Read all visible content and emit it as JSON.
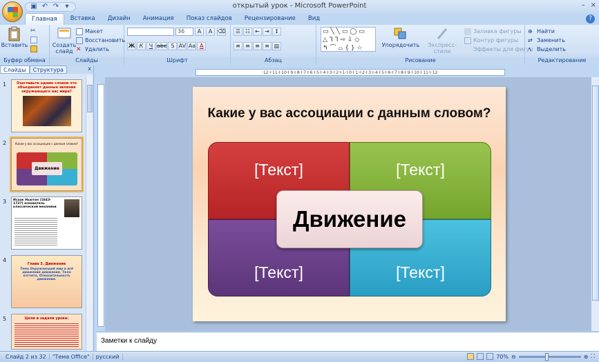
{
  "window": {
    "title": "открытый урок - Microsoft PowerPoint",
    "minimize": "–",
    "close": "×"
  },
  "tabs": [
    "Главная",
    "Вставка",
    "Дизайн",
    "Анимация",
    "Показ слайдов",
    "Рецензирование",
    "Вид"
  ],
  "ribbon": {
    "clipboard": {
      "paste": "Вставить",
      "label": "Буфер обмена"
    },
    "slides": {
      "create": "Создать слайд",
      "layout": "Макет",
      "restore": "Восстановить",
      "delete": "Удалить",
      "label": "Слайды"
    },
    "font": {
      "size": "36",
      "label": "Шрифт",
      "bold": "Ж",
      "italic": "К",
      "underline": "Ч",
      "strike": "abc",
      "shadow": "S",
      "spacing": "AV",
      "case": "Aa",
      "color": "A",
      "grow": "A",
      "shrink": "A"
    },
    "paragraph": {
      "label": "Абзац"
    },
    "drawing": {
      "arrange": "Упорядочить",
      "quickstyles": "Экспресс-стили",
      "fill": "Заливка фигуры",
      "outline": "Контур фигуры",
      "effects": "Эффекты для фигур",
      "label": "Рисование"
    },
    "editing": {
      "find": "Найти",
      "replace": "Заменить",
      "select": "Выделить",
      "label": "Редактирование"
    }
  },
  "left_panel": {
    "tab_slides": "Слайды",
    "tab_outline": "Структура",
    "close": "x",
    "slides": [
      {
        "num": "1",
        "text": "Озаглавьте одним словом что объединяет данные явления окружающего нас мира?"
      },
      {
        "num": "2",
        "text": "Какие у вас ассоциации с данным словом?",
        "center": "Движение"
      },
      {
        "num": "3",
        "text": "Исаак Ньютон (1643–1727) основатель классической механики"
      },
      {
        "num": "4",
        "text": "Глава 3. Движение",
        "sub": "Тема Окружающий мир в всё движение движение. Тело отсчета. Относительность движения."
      },
      {
        "num": "5",
        "text": "Цели и задачи урока:"
      }
    ]
  },
  "ruler": "·12·I·11·I·10·I·9·I·8·I·7·I·6·I·5·I·4·I·3·I·2·I·1·I·0·I·1·I·2·I·3·I·4·I·5·I·6·I·7·I·8·I·9·I·10·I·11·I·12·",
  "slide": {
    "title": "Какие у вас ассоциации с данным словом?",
    "quad_tl": "[Текст]",
    "quad_tr": "[Текст]",
    "quad_bl": "[Текст]",
    "quad_br": "[Текст]",
    "center": "Движение"
  },
  "notes": "Заметки к слайду",
  "status": {
    "slide": "Слайд 2 из 32",
    "theme": "\"Тема Office\"",
    "lang": "русский",
    "zoom": "70%"
  },
  "colors": {
    "red": "#c9302f",
    "green": "#86b43d",
    "purple": "#6b418a",
    "blue": "#38b0d3"
  }
}
